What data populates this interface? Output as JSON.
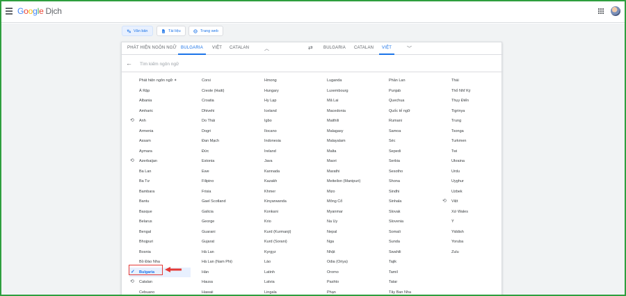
{
  "header": {
    "logo": "Google",
    "product": "Dịch"
  },
  "modes": [
    {
      "label": "Văn bản",
      "icon": "translate-icon"
    },
    {
      "label": "Tài liệu",
      "icon": "document-icon"
    },
    {
      "label": "Trang web",
      "icon": "globe-icon"
    }
  ],
  "source_tabs": [
    "PHÁT HIỆN NGÔN NGỮ",
    "BULGARIA",
    "VIỆT",
    "CATALAN"
  ],
  "target_tabs": [
    "BULGARIA",
    "CATALAN",
    "VIỆT"
  ],
  "search": {
    "placeholder": "Tìm kiếm ngôn ngữ",
    "value": ""
  },
  "columns": [
    [
      "Phát hiện ngôn ngữ",
      "Á Rập",
      "Albania",
      "Amharic",
      "Anh",
      "Armenia",
      "Assam",
      "Aymara",
      "Azerbaijan",
      "Ba Lan",
      "Ba Tư",
      "Bambara",
      "Bantu",
      "Basque",
      "Belarus",
      "Bengal",
      "Bhojpuri",
      "Bosnia",
      "Bồ Đào Nha",
      "Bulgaria",
      "Catalan",
      "Cebuano"
    ],
    [
      "Corsi",
      "Creole (Haiti)",
      "Croatia",
      "Dhivehi",
      "Do Thái",
      "Dogri",
      "Đan Mạch",
      "Đức",
      "Estonia",
      "Ewe",
      "Filipino",
      "Frisia",
      "Gael Scotland",
      "Galicia",
      "George",
      "Guarani",
      "Gujarat",
      "Hà Lan",
      "Hà Lan (Nam Phi)",
      "Hàn",
      "Hausa",
      "Hawaii"
    ],
    [
      "Hmong",
      "Hungary",
      "Hy Lạp",
      "Iceland",
      "Igbo",
      "Ilocano",
      "Indonesia",
      "Ireland",
      "Java",
      "Kannada",
      "Kazakh",
      "Khmer",
      "Kinyarwanda",
      "Konkani",
      "Krio",
      "Kurd (Kurmanji)",
      "Kurd (Sorani)",
      "Kyrgyz",
      "Lào",
      "Latinh",
      "Latvia",
      "Lingala"
    ],
    [
      "Luganda",
      "Luxembourg",
      "Mã Lai",
      "Macedonia",
      "Maithili",
      "Malagasy",
      "Malayalam",
      "Malta",
      "Maori",
      "Marathi",
      "Meiteilon (Manipuri)",
      "Mizo",
      "Mông Cổ",
      "Myanmar",
      "Na Uy",
      "Nepal",
      "Nga",
      "Nhật",
      "Odia (Oriya)",
      "Oromo",
      "Pashto",
      "Phạn"
    ],
    [
      "Phần Lan",
      "Punjab",
      "Quechua",
      "Quốc tế ngữ",
      "Rumani",
      "Samoa",
      "Séc",
      "Sepedi",
      "Serbia",
      "Sesotho",
      "Shona",
      "Sindhi",
      "Sinhala",
      "Slovak",
      "Slovenia",
      "Somali",
      "Sunda",
      "Swahili",
      "Tajik",
      "Tamil",
      "Tatar",
      "Tây Ban Nha"
    ],
    [
      "Thái",
      "Thổ Nhĩ Kỳ",
      "Thụy Điển",
      "Tigrinya",
      "Trung",
      "Tsonga",
      "Turkmen",
      "Twi",
      "Ukraina",
      "Urdu",
      "Uyghur",
      "Uzbek",
      "Việt",
      "Xứ Wales",
      "Ý",
      "Yiddish",
      "Yoruba",
      "Zulu"
    ]
  ],
  "recent_icon": "history-icon",
  "selected_icon": "checkmark-icon",
  "detect_icon": "sparkle-icon",
  "colors": {
    "accent": "#1a73e8",
    "highlight": "#e53935",
    "frame": "#2e9e3e"
  }
}
